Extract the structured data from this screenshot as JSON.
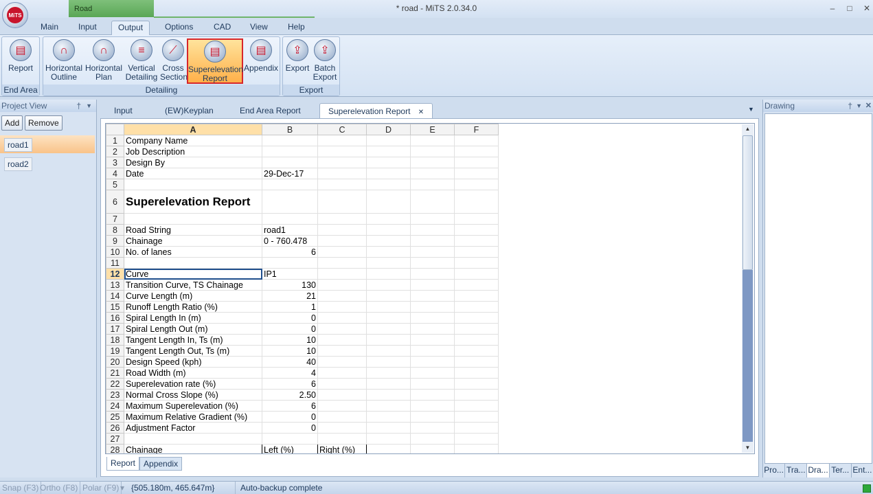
{
  "window": {
    "title": "* road - MiTS 2.0.34.0",
    "app_logo_text": "MiTS",
    "context_tab": "Road",
    "minimize": "–",
    "maximize": "□",
    "close": "✕"
  },
  "ribbon_tabs": [
    "Main",
    "Input",
    "Output",
    "Options",
    "CAD",
    "View",
    "Help"
  ],
  "ribbon_active_tab": "Output",
  "ribbon": {
    "groups": [
      {
        "label": "End Area",
        "buttons": [
          "Report"
        ]
      },
      {
        "label": "Detailing",
        "buttons": [
          "Horizontal Outline",
          "Horizontal Plan",
          "Vertical Detailing",
          "Cross Section",
          "Superelevation Report",
          "Appendix"
        ]
      },
      {
        "label": "Export",
        "buttons": [
          "Export",
          "Batch Export"
        ]
      }
    ],
    "selected_button": "Superelevation Report",
    "button_lines": {
      "report": [
        "Report",
        ""
      ],
      "horizontal_outline": [
        "Horizontal",
        "Outline"
      ],
      "horizontal_plan": [
        "Horizontal",
        "Plan"
      ],
      "vertical_detailing": [
        "Vertical",
        "Detailing"
      ],
      "cross_section": [
        "Cross",
        "Section"
      ],
      "superelevation_report": [
        "Superelevation",
        "Report"
      ],
      "appendix": [
        "Appendix",
        ""
      ],
      "export": [
        "Export",
        ""
      ],
      "batch_export": [
        "Batch",
        "Export"
      ]
    }
  },
  "project_view": {
    "title": "Project View",
    "pin": "†",
    "dropdown": "▼",
    "add_label": "Add",
    "remove_label": "Remove",
    "items": [
      "road1",
      "road2"
    ],
    "selected_item": "road1"
  },
  "drawing_panel": {
    "title": "Drawing",
    "pin": "†",
    "dropdown": "▼",
    "close": "✕",
    "tabs": [
      "Pro...",
      "Tra...",
      "Dra...",
      "Ter...",
      "Ent..."
    ],
    "active_tab": "Dra..."
  },
  "document_tabs": {
    "tabs": [
      "Input",
      "(EW)Keyplan",
      "End Area Report",
      "Superelevation Report"
    ],
    "active": "Superelevation Report",
    "close_icon": "✕",
    "dropdown": "▼"
  },
  "spreadsheet": {
    "columns": [
      "A",
      "B",
      "C",
      "D",
      "E",
      "F"
    ],
    "selected_column": "A",
    "selected_row": 12,
    "rows": [
      {
        "n": "1",
        "a": "Company Name",
        "b": "",
        "c": ""
      },
      {
        "n": "2",
        "a": "Job Description",
        "b": "",
        "c": ""
      },
      {
        "n": "3",
        "a": "Design By",
        "b": "",
        "c": ""
      },
      {
        "n": "4",
        "a": "Date",
        "b": "29-Dec-17",
        "c": ""
      },
      {
        "n": "5",
        "a": "",
        "b": "",
        "c": ""
      },
      {
        "n": "6",
        "a": "Superelevation Report",
        "b": "",
        "c": ""
      },
      {
        "n": "7",
        "a": "",
        "b": "",
        "c": ""
      },
      {
        "n": "8",
        "a": "Road String",
        "b": "road1",
        "c": ""
      },
      {
        "n": "9",
        "a": "Chainage",
        "b": "0 - 760.478",
        "c": ""
      },
      {
        "n": "10",
        "a": "No. of lanes",
        "b": "6",
        "c": ""
      },
      {
        "n": "11",
        "a": "",
        "b": "",
        "c": ""
      },
      {
        "n": "12",
        "a": "Curve",
        "b": "IP1",
        "c": ""
      },
      {
        "n": "13",
        "a": "Transition Curve, TS Chainage",
        "b": "130",
        "c": ""
      },
      {
        "n": "14",
        "a": "Curve Length (m)",
        "b": "21",
        "c": ""
      },
      {
        "n": "15",
        "a": "Runoff Length Ratio (%)",
        "b": "1",
        "c": ""
      },
      {
        "n": "16",
        "a": "Spiral Length In (m)",
        "b": "0",
        "c": ""
      },
      {
        "n": "17",
        "a": "Spiral Length Out (m)",
        "b": "0",
        "c": ""
      },
      {
        "n": "18",
        "a": "Tangent Length In, Ts (m)",
        "b": "10",
        "c": ""
      },
      {
        "n": "19",
        "a": "Tangent Length Out, Ts (m)",
        "b": "10",
        "c": ""
      },
      {
        "n": "20",
        "a": "Design Speed (kph)",
        "b": "40",
        "c": ""
      },
      {
        "n": "21",
        "a": "Road Width (m)",
        "b": "4",
        "c": ""
      },
      {
        "n": "22",
        "a": "Superelevation rate (%)",
        "b": "6",
        "c": ""
      },
      {
        "n": "23",
        "a": "Normal Cross Slope (%)",
        "b": "2.50",
        "c": ""
      },
      {
        "n": "24",
        "a": "Maximum Superelevation (%)",
        "b": "6",
        "c": ""
      },
      {
        "n": "25",
        "a": "Maximum Relative Gradient (%)",
        "b": "0",
        "c": ""
      },
      {
        "n": "26",
        "a": "Adjustment Factor",
        "b": "0",
        "c": ""
      },
      {
        "n": "27",
        "a": "",
        "b": "",
        "c": ""
      },
      {
        "n": "28",
        "a": "Chainage",
        "b": "Left (%)",
        "c": "Right (%)"
      }
    ],
    "sheet_tabs": [
      "Report",
      "Appendix"
    ],
    "active_sheet": "Report"
  },
  "status_bar": {
    "snap": "Snap (F3)",
    "ortho": "Ortho (F8)",
    "polar": "Polar (F9)",
    "polar_dropdown": "▾",
    "coords": "{505.180m, 465.647m}",
    "message": "Auto-backup complete"
  }
}
